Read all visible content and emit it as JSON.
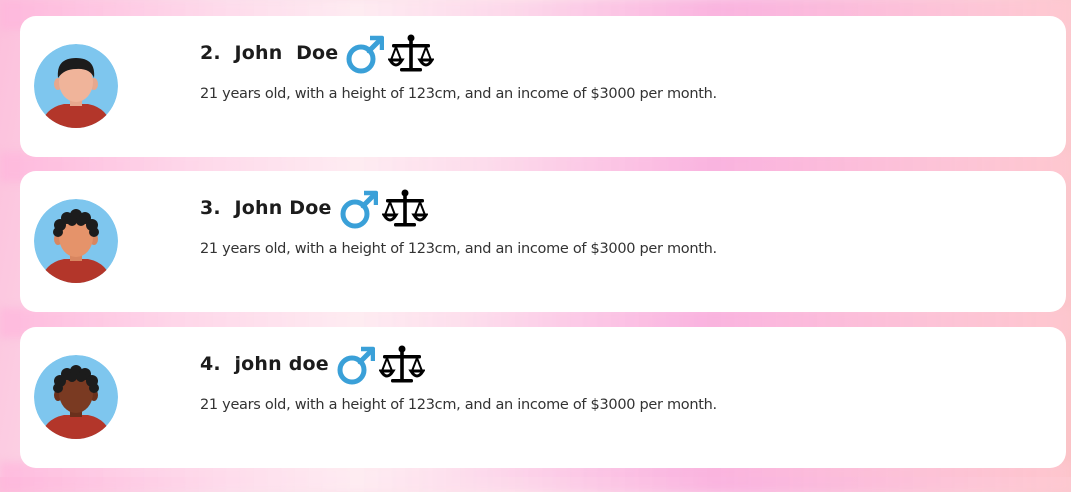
{
  "people": [
    {
      "title": "2.  John  Doe",
      "description": "21 years old, with a height of 123cm, and an income of $3000 per month.",
      "gender_icon": "male-symbol-icon",
      "trait_icon": "balance-scales-icon",
      "avatar": {
        "skin": "#f0b49a",
        "hair": "curly-none",
        "hair_color": "#1c1c1c",
        "shirt": "#b3362a",
        "background": "#7ec6ee"
      }
    },
    {
      "title": "3.  John Doe",
      "description": "21 years old, with a height of 123cm, and an income of $3000 per month.",
      "gender_icon": "male-symbol-icon",
      "trait_icon": "balance-scales-icon",
      "avatar": {
        "skin": "#e5936a",
        "hair": "curly",
        "hair_color": "#1c1c1c",
        "shirt": "#b3362a",
        "background": "#7ec6ee"
      }
    },
    {
      "title": "4.  john doe",
      "description": "21 years old, with a height of 123cm, and an income of $3000 per month.",
      "gender_icon": "male-symbol-icon",
      "trait_icon": "balance-scales-icon",
      "avatar": {
        "skin": "#7a3a22",
        "hair": "curly",
        "hair_color": "#1c1c1c",
        "shirt": "#b3362a",
        "background": "#7ec6ee"
      }
    }
  ],
  "colors": {
    "gender_blue": "#3aa0d8",
    "card_bg": "#ffffff"
  }
}
